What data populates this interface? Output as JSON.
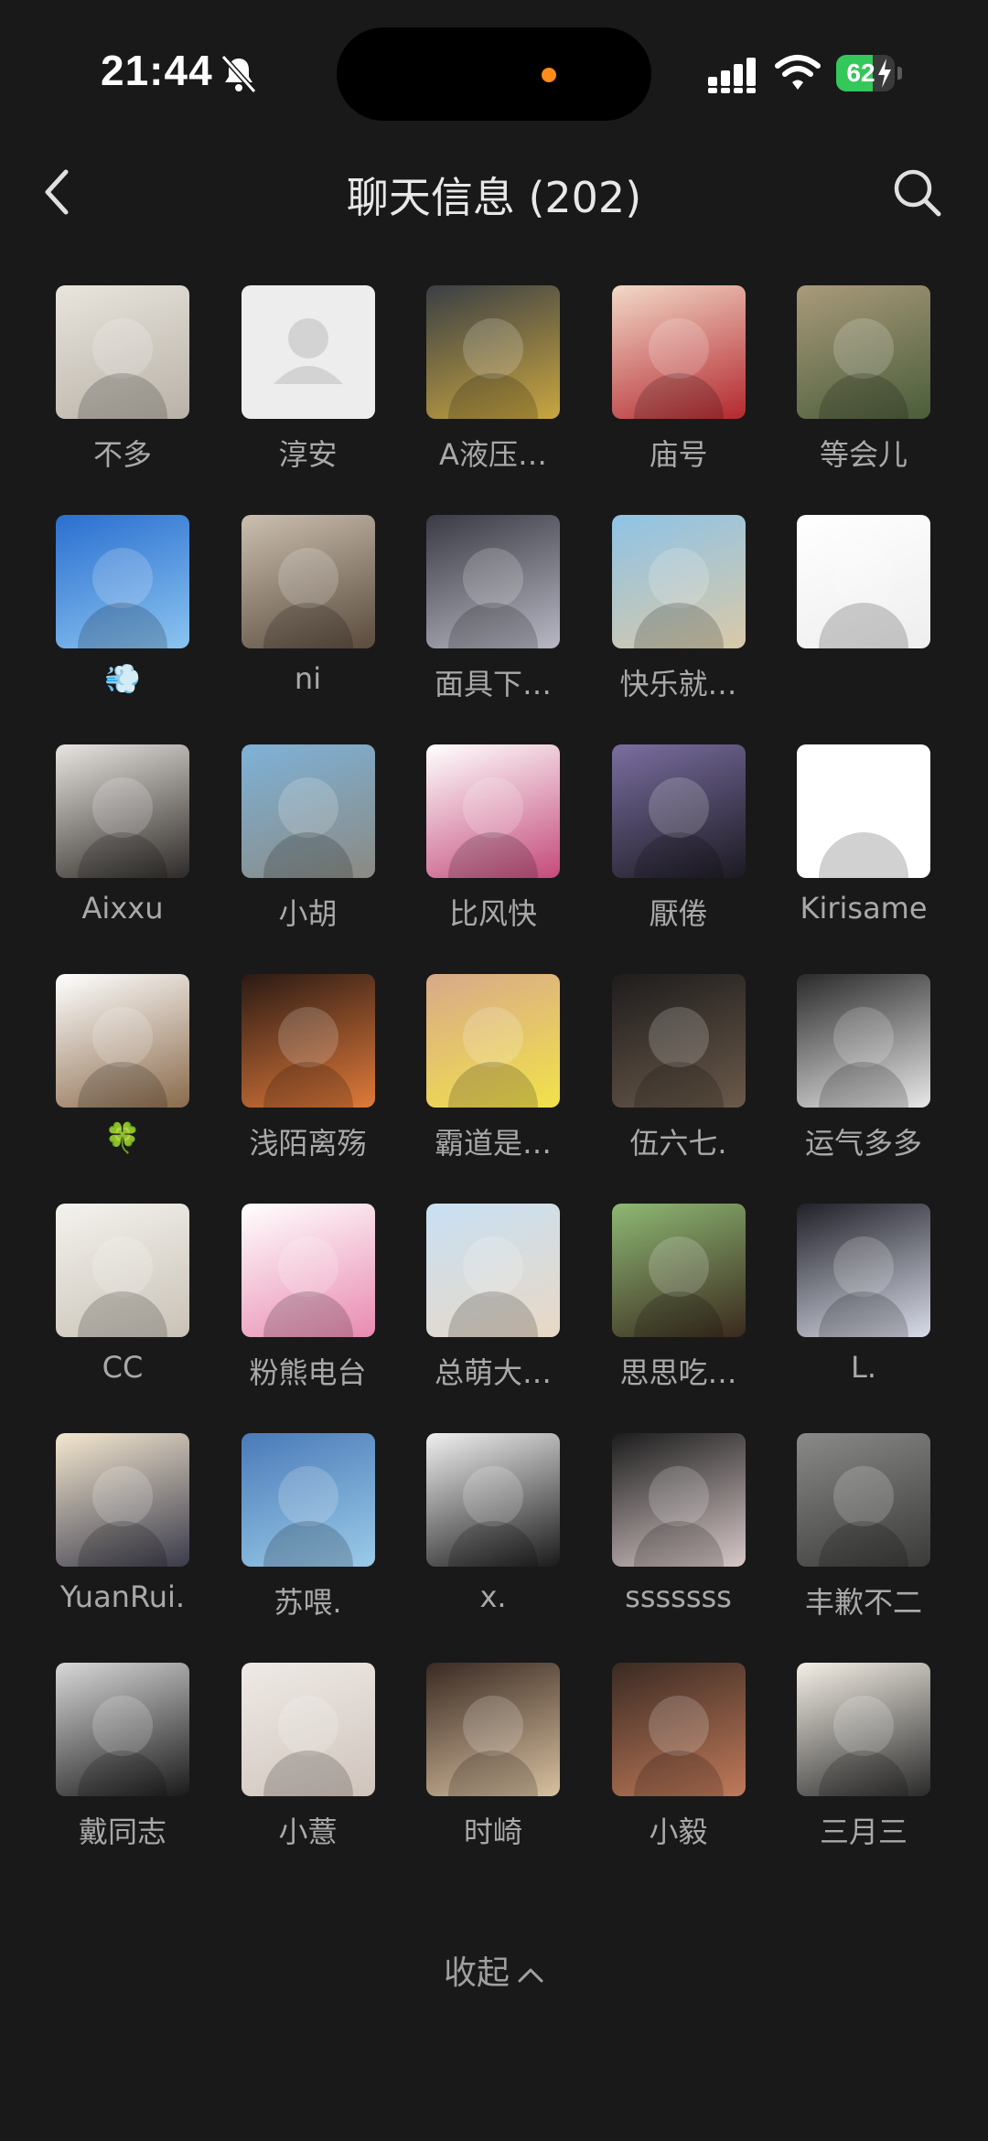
{
  "status_bar": {
    "time": "21:44",
    "battery": "62",
    "battery_level": 0.62
  },
  "header": {
    "title": "聊天信息 (202)"
  },
  "members": [
    {
      "name": "不多",
      "colors": [
        "#e9e4dc",
        "#b8b2a8"
      ],
      "art": "rainbow"
    },
    {
      "name": "淳安",
      "colors": [
        "#efefef",
        "#efefef"
      ],
      "art": "default"
    },
    {
      "name": "A液压…",
      "colors": [
        "#3a3f45",
        "#c9a640"
      ],
      "art": "lift"
    },
    {
      "name": "庙号",
      "colors": [
        "#f2d9c8",
        "#b4272e"
      ],
      "art": "anime"
    },
    {
      "name": "等会儿",
      "colors": [
        "#a99a7b",
        "#4a5d3a"
      ],
      "art": "group"
    },
    {
      "name": "💨",
      "colors": [
        "#2a6fd0",
        "#8bc4f0"
      ],
      "art": "girl"
    },
    {
      "name": "ni",
      "colors": [
        "#cbbfb0",
        "#5a4b3c"
      ],
      "art": "dog"
    },
    {
      "name": "面具下…",
      "colors": [
        "#3a3a44",
        "#b8b8c4"
      ],
      "art": "manga"
    },
    {
      "name": "快乐就…",
      "colors": [
        "#8ec3e6",
        "#d9c9a8"
      ],
      "art": "couple"
    },
    {
      "name": "",
      "colors": [
        "#ffffff",
        "#eeeeee"
      ],
      "art": "cat"
    },
    {
      "name": "Aixxu",
      "colors": [
        "#e8e4df",
        "#2d2a27"
      ],
      "art": "room"
    },
    {
      "name": "小胡",
      "colors": [
        "#7eb2d8",
        "#8a8a82"
      ],
      "art": "street"
    },
    {
      "name": "比风快",
      "colors": [
        "#ffffff",
        "#c44a7a"
      ],
      "art": "hero"
    },
    {
      "name": "厭倦",
      "colors": [
        "#7a6ea0",
        "#1c1a22"
      ],
      "art": "silhouette"
    },
    {
      "name": "Kirisame",
      "colors": [
        "#ffffff",
        "#ffffff"
      ],
      "art": "sketch"
    },
    {
      "name": "🍀",
      "colors": [
        "#ffffff",
        "#8a6a4a"
      ],
      "art": "doll"
    },
    {
      "name": "浅陌离殇",
      "colors": [
        "#2a1a14",
        "#e07a3a"
      ],
      "art": "firework"
    },
    {
      "name": "霸道是…",
      "colors": [
        "#d8a98a",
        "#f2e24a"
      ],
      "art": "photo"
    },
    {
      "name": "伍六七.",
      "colors": [
        "#1e1c1c",
        "#6a5a4a"
      ],
      "art": "car"
    },
    {
      "name": "运气多多",
      "colors": [
        "#2a2a2a",
        "#e8e8e8"
      ],
      "art": "doctor"
    },
    {
      "name": "CC",
      "colors": [
        "#f4f2ee",
        "#c9c2b6"
      ],
      "art": "baby"
    },
    {
      "name": "粉熊电台",
      "colors": [
        "#ffffff",
        "#e88ab0"
      ],
      "art": "bear"
    },
    {
      "name": "总萌大…",
      "colors": [
        "#c8e0f4",
        "#e8d8c4"
      ],
      "art": "angel"
    },
    {
      "name": "思思吃…",
      "colors": [
        "#8eb874",
        "#3a2a1e"
      ],
      "art": "curly"
    },
    {
      "name": "L.",
      "colors": [
        "#202028",
        "#d8dce8"
      ],
      "art": "moon"
    },
    {
      "name": "YuanRui.",
      "colors": [
        "#f4e8d0",
        "#3a3a4a"
      ],
      "art": "cartoon-couple"
    },
    {
      "name": "苏喂.",
      "colors": [
        "#4a7ab8",
        "#9acbe8"
      ],
      "art": "back"
    },
    {
      "name": "x.",
      "colors": [
        "#f0f0f0",
        "#1a1a1a"
      ],
      "art": "shadow"
    },
    {
      "name": "sssssss",
      "colors": [
        "#1c1c1c",
        "#d8c8c8"
      ],
      "art": "street-girl"
    },
    {
      "name": "丰歉不二",
      "colors": [
        "#8a8a88",
        "#3a3a38"
      ],
      "art": "walker"
    },
    {
      "name": "戴同志",
      "colors": [
        "#d8d8d8",
        "#1a1a1a"
      ],
      "art": "suit"
    },
    {
      "name": "小薏",
      "colors": [
        "#efeae6",
        "#cfc4bc"
      ],
      "art": "kitten"
    },
    {
      "name": "时崎",
      "colors": [
        "#3a2a22",
        "#d8c0a0"
      ],
      "art": "anime2"
    },
    {
      "name": "小毅",
      "colors": [
        "#3a2a22",
        "#c07a5a"
      ],
      "art": "table"
    },
    {
      "name": "三月三",
      "colors": [
        "#f4efe6",
        "#2a2a2a"
      ],
      "art": "boy"
    }
  ],
  "footer": {
    "collapse_label": "收起"
  }
}
